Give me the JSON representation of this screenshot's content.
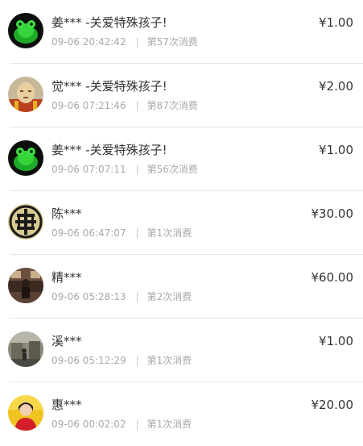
{
  "donations": [
    {
      "name": "姜*** -关爱特殊孩子!",
      "time": "09-06 20:42:42",
      "sep": "|",
      "count": "第57次消费",
      "amount": "¥1.00",
      "avatar": "green-frog-avatar"
    },
    {
      "name": "觉*** -关爱特殊孩子!",
      "time": "09-06 07:21:46",
      "sep": "|",
      "count": "第87次消费",
      "amount": "¥2.00",
      "avatar": "monk-avatar"
    },
    {
      "name": "姜*** -关爱特殊孩子!",
      "time": "09-06 07:07:11",
      "sep": "|",
      "count": "第56次消费",
      "amount": "¥1.00",
      "avatar": "green-frog-avatar"
    },
    {
      "name": "陈***",
      "time": "09-06 06:47:07",
      "sep": "|",
      "count": "第1次消费",
      "amount": "¥30.00",
      "avatar": "emblem-avatar"
    },
    {
      "name": "精***",
      "time": "09-06 05:28:13",
      "sep": "|",
      "count": "第2次消费",
      "amount": "¥60.00",
      "avatar": "room-photo-avatar"
    },
    {
      "name": "溪***",
      "time": "09-06 05:12:29",
      "sep": "|",
      "count": "第1次消费",
      "amount": "¥1.00",
      "avatar": "street-photo-avatar"
    },
    {
      "name": "惠***",
      "time": "09-06 00:02:02",
      "sep": "|",
      "count": "第1次消费",
      "amount": "¥20.00",
      "avatar": "person-photo-avatar"
    }
  ]
}
